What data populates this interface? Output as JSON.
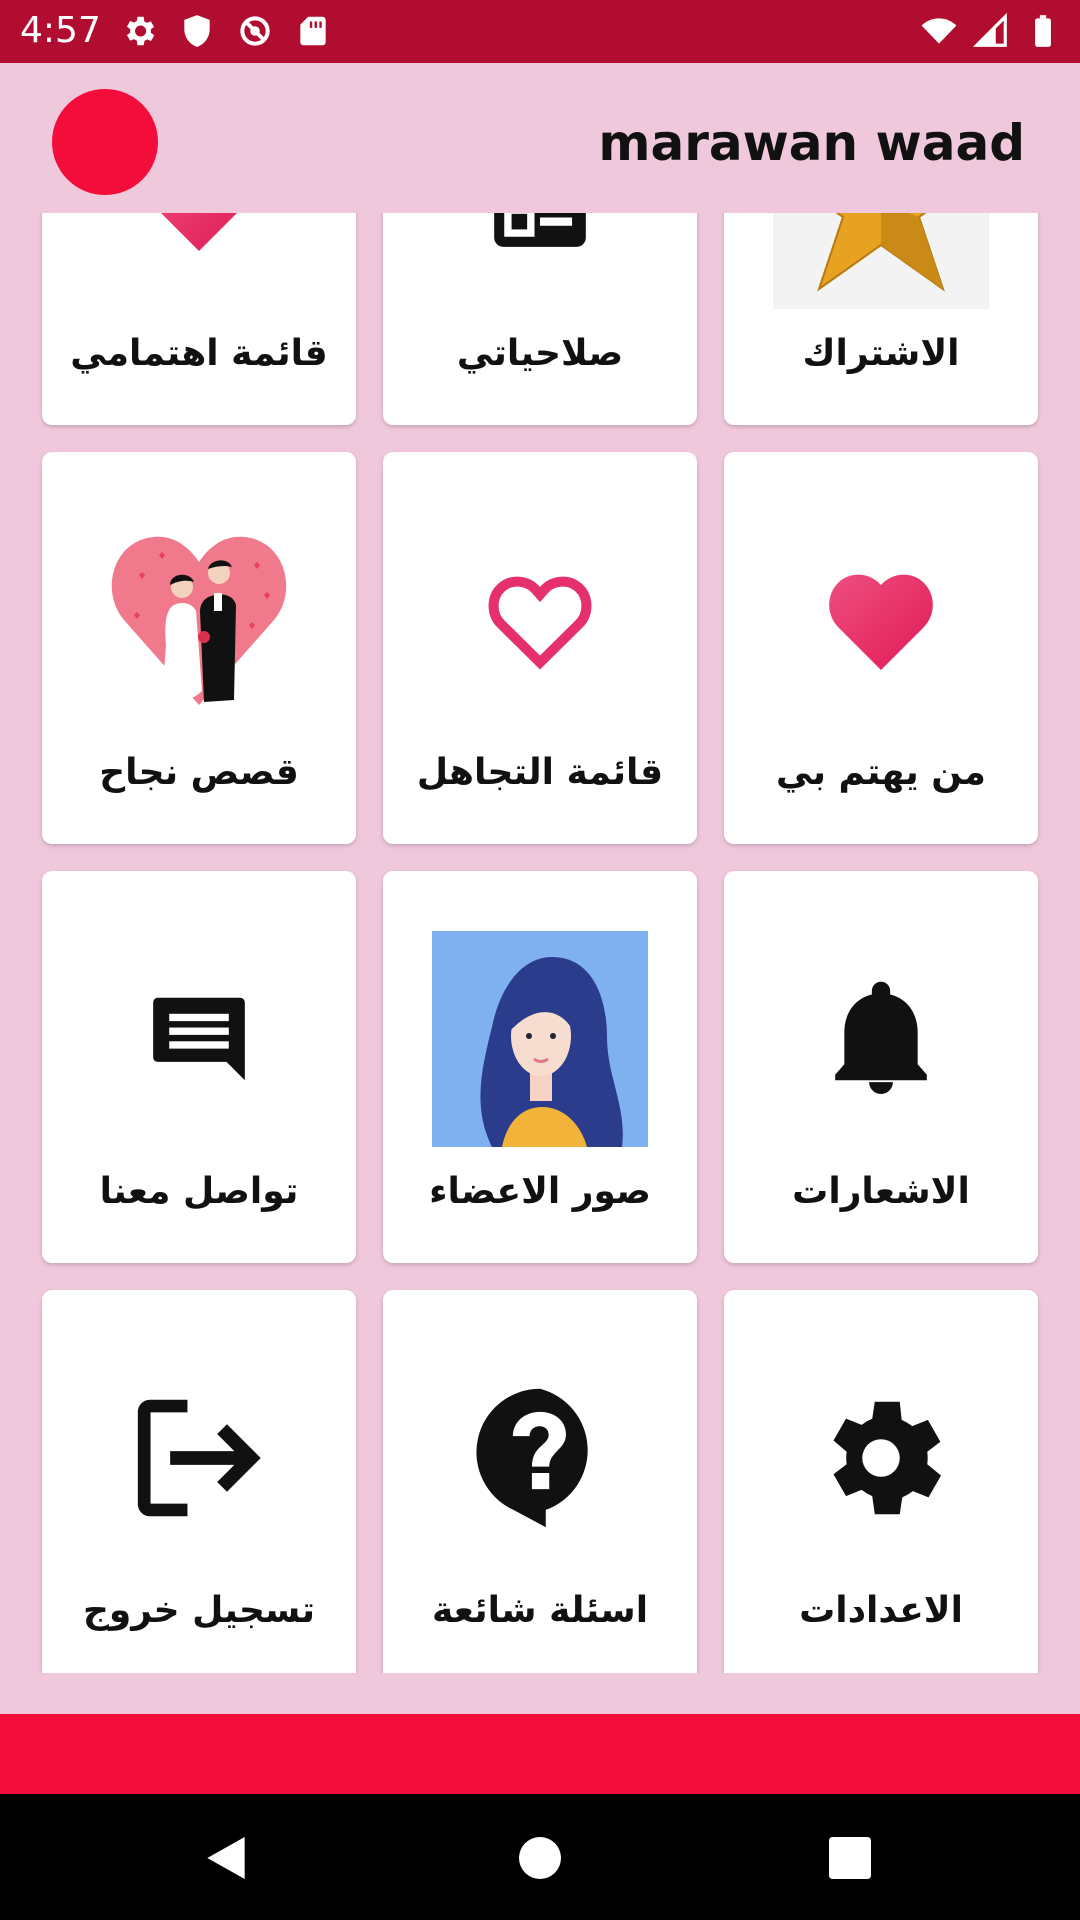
{
  "status_bar": {
    "time": "4:57",
    "background": "#b00d30",
    "left_icons": [
      "gear-icon",
      "shield-icon",
      "no-sync-icon",
      "sd-card-icon"
    ],
    "right_icons": [
      "wifi-icon",
      "signal-icon",
      "battery-icon"
    ]
  },
  "header": {
    "title": "marawan waad",
    "avatar_color": "#f20d3a"
  },
  "grid": {
    "items": [
      {
        "label": "الاشتراك",
        "icon": "star-icon"
      },
      {
        "label": "صلاحياتي",
        "icon": "checklist-icon"
      },
      {
        "label": "قائمة اهتمامي",
        "icon": "heart-filled-icon"
      },
      {
        "label": "من يهتم بي",
        "icon": "heart-filled-icon"
      },
      {
        "label": "قائمة التجاهل",
        "icon": "heart-outline-icon"
      },
      {
        "label": "قصص نجاح",
        "icon": "couple-heart-icon"
      },
      {
        "label": "الاشعارات",
        "icon": "bell-icon"
      },
      {
        "label": "صور الاعضاء",
        "icon": "woman-portrait-icon"
      },
      {
        "label": "تواصل معنا",
        "icon": "chat-icon"
      },
      {
        "label": "الاعدادات",
        "icon": "settings-gear-icon"
      },
      {
        "label": "اسئلة شائعة",
        "icon": "help-bubble-icon"
      },
      {
        "label": "تسجيل خروج",
        "icon": "logout-icon"
      }
    ]
  },
  "colors": {
    "page_background": "#f0c8dc",
    "accent": "#f20d3a",
    "heart_pink": "#e8306a"
  },
  "nav_bar": {
    "buttons": [
      "back-icon",
      "home-icon",
      "recents-icon"
    ]
  }
}
